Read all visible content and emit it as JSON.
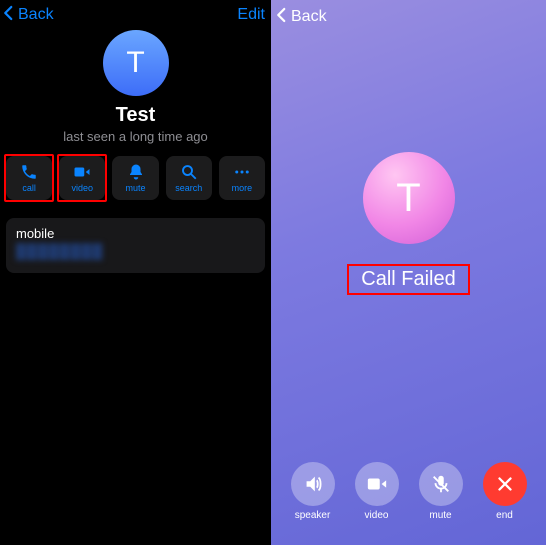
{
  "left": {
    "back_label": "Back",
    "edit_label": "Edit",
    "avatar_letter": "T",
    "name": "Test",
    "status": "last seen a long time ago",
    "actions": [
      {
        "label": "call"
      },
      {
        "label": "video"
      },
      {
        "label": "mute"
      },
      {
        "label": "search"
      },
      {
        "label": "more"
      }
    ],
    "field": {
      "label": "mobile",
      "value": "████████"
    }
  },
  "right": {
    "back_label": "Back",
    "avatar_letter": "T",
    "call_status": "Call Failed",
    "buttons": [
      {
        "label": "speaker"
      },
      {
        "label": "video"
      },
      {
        "label": "mute"
      },
      {
        "label": "end"
      }
    ]
  }
}
